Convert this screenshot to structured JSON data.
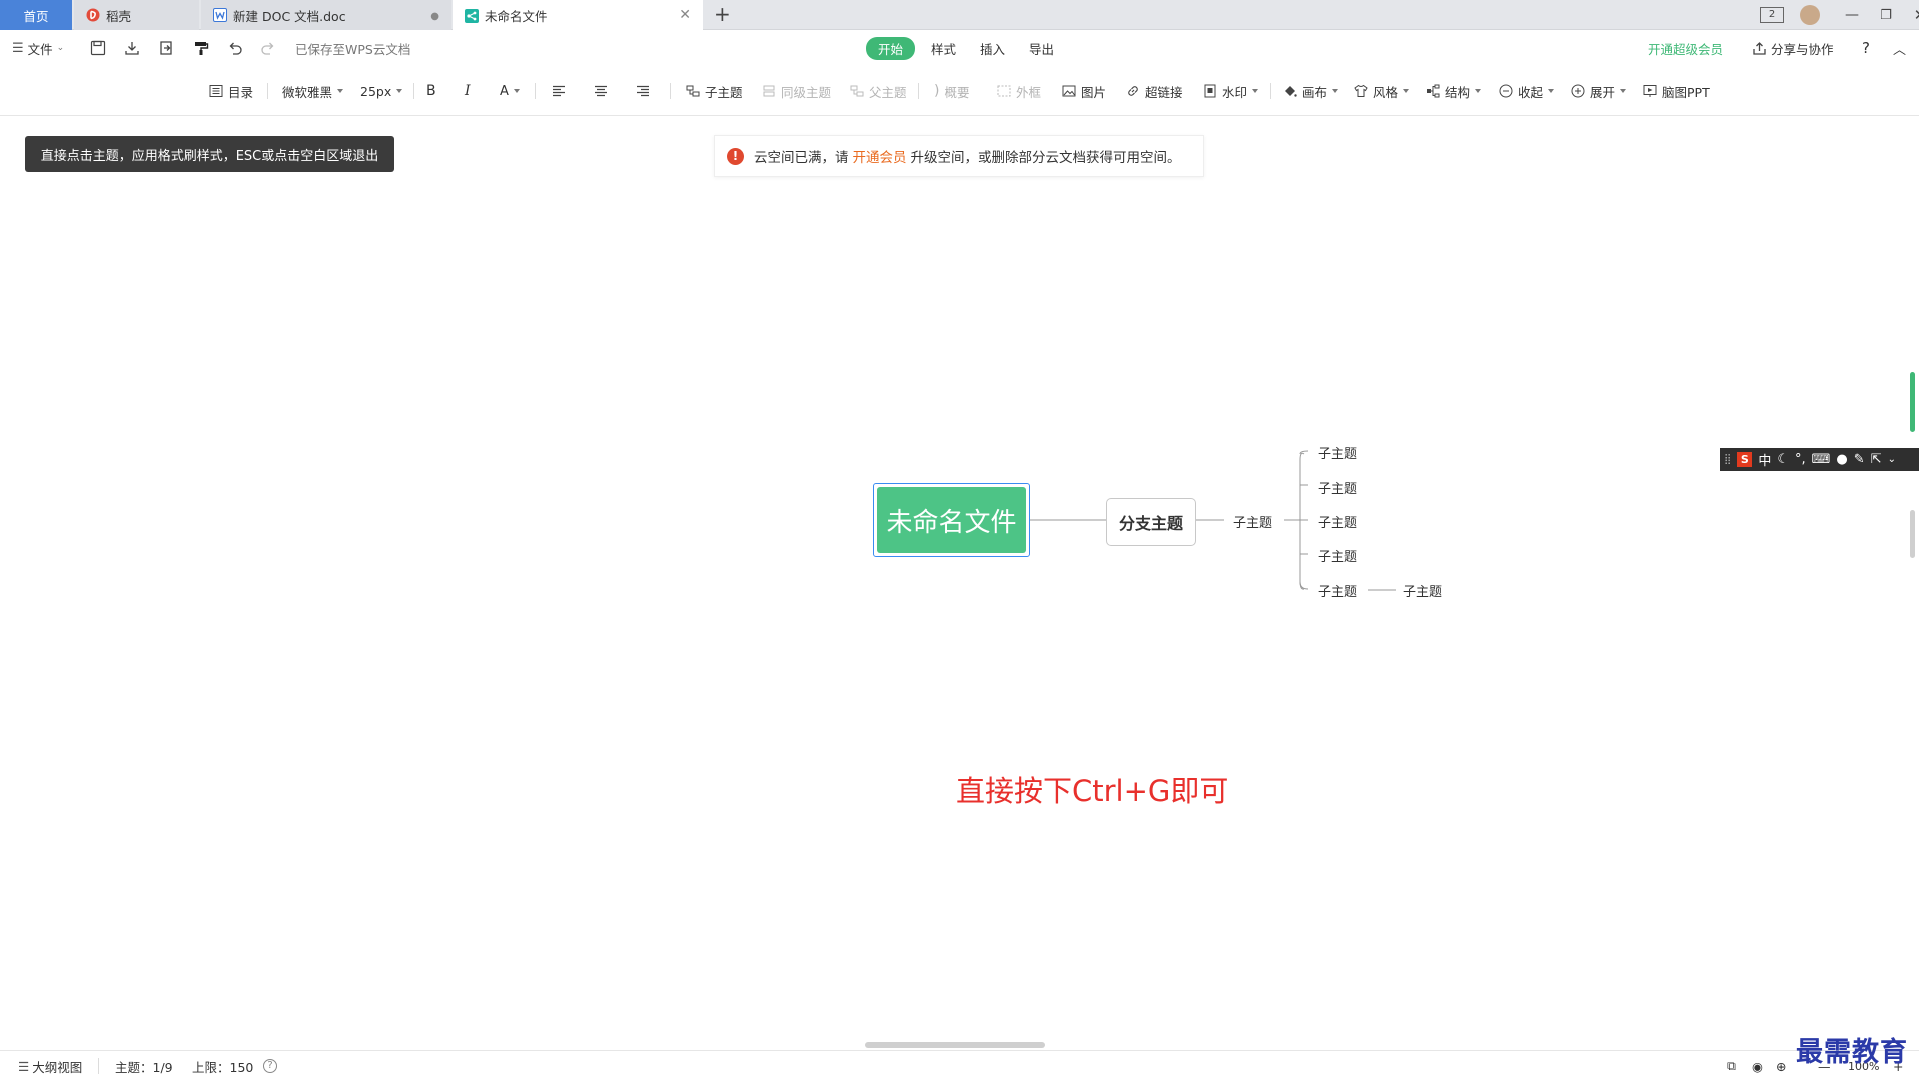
{
  "tabs": {
    "home": "首页",
    "daoke": "稻壳",
    "doc": "新建 DOC 文档.doc",
    "mind": "未命名文件",
    "new_tab": "+"
  },
  "window": {
    "badge": "2"
  },
  "menu": {
    "file": "文件",
    "saved_status": "已保存至WPS云文档",
    "ribbon_tabs": [
      "开始",
      "样式",
      "插入",
      "导出"
    ],
    "vip": "开通超级会员",
    "share": "分享与协作",
    "help": "?"
  },
  "toolbar": {
    "outline": "目录",
    "font": "微软雅黑",
    "size": "25px",
    "bold": "B",
    "italic": "I",
    "font_color": "A",
    "child_topic": "子主题",
    "sibling_topic": "同级主题",
    "parent_topic": "父主题",
    "summary": "概要",
    "frame": "外框",
    "image": "图片",
    "hyperlink": "超链接",
    "watermark": "水印",
    "canvas": "画布",
    "style": "风格",
    "structure": "结构",
    "collapse": "收起",
    "expand": "展开",
    "mind_ppt": "脑图PPT"
  },
  "canvas": {
    "tooltip": "直接点击主题，应用格式刷样式，ESC或点击空白区域退出",
    "notice_prefix": "云空间已满，请",
    "notice_link": "开通会员",
    "notice_suffix": "升级空间，或删除部分云文档获得可用空间。",
    "root_topic": "未命名文件",
    "branch_topic": "分支主题",
    "level2_topic": "子主题",
    "level3_topics": [
      "子主题",
      "子主题",
      "子主题",
      "子主题",
      "子主题"
    ],
    "level4_topic": "子主题",
    "instruction": "直接按下Ctrl+G即可"
  },
  "ime": {
    "logo": "S",
    "mode": "中"
  },
  "status": {
    "outline_view": "大纲视图",
    "topic_count": "主题：1/9",
    "limit": "上限：150",
    "zoom": "100%"
  },
  "watermark_text": "最需教育",
  "colors": {
    "accent_green": "#3fb876",
    "root_green": "#4dc486",
    "home_tab_blue": "#4a83d9",
    "selection_blue": "#3a8cf2",
    "error_red": "#e0492f",
    "link_orange": "#e96a1f",
    "instruction_red": "#e8302c"
  }
}
